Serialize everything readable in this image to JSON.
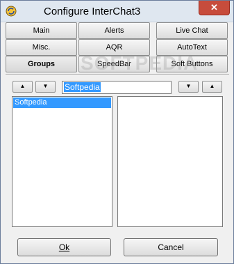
{
  "window": {
    "title": "Configure InterChat3",
    "close_symbol": "✕"
  },
  "tabs": {
    "row1": [
      "Main",
      "Alerts",
      "Live Chat"
    ],
    "row2": [
      "Misc.",
      "AQR",
      "AutoText"
    ],
    "row3": [
      "Groups",
      "SpeedBar",
      "Soft Buttons"
    ],
    "active": "Groups"
  },
  "controls": {
    "up_glyph": "▲",
    "down_glyph": "▼",
    "name_value": "Softpedia"
  },
  "lists": {
    "left_items": [
      "Softpedia"
    ],
    "right_items": []
  },
  "buttons": {
    "ok": "Ok",
    "cancel": "Cancel"
  },
  "watermark": "SOFTPEDIA"
}
